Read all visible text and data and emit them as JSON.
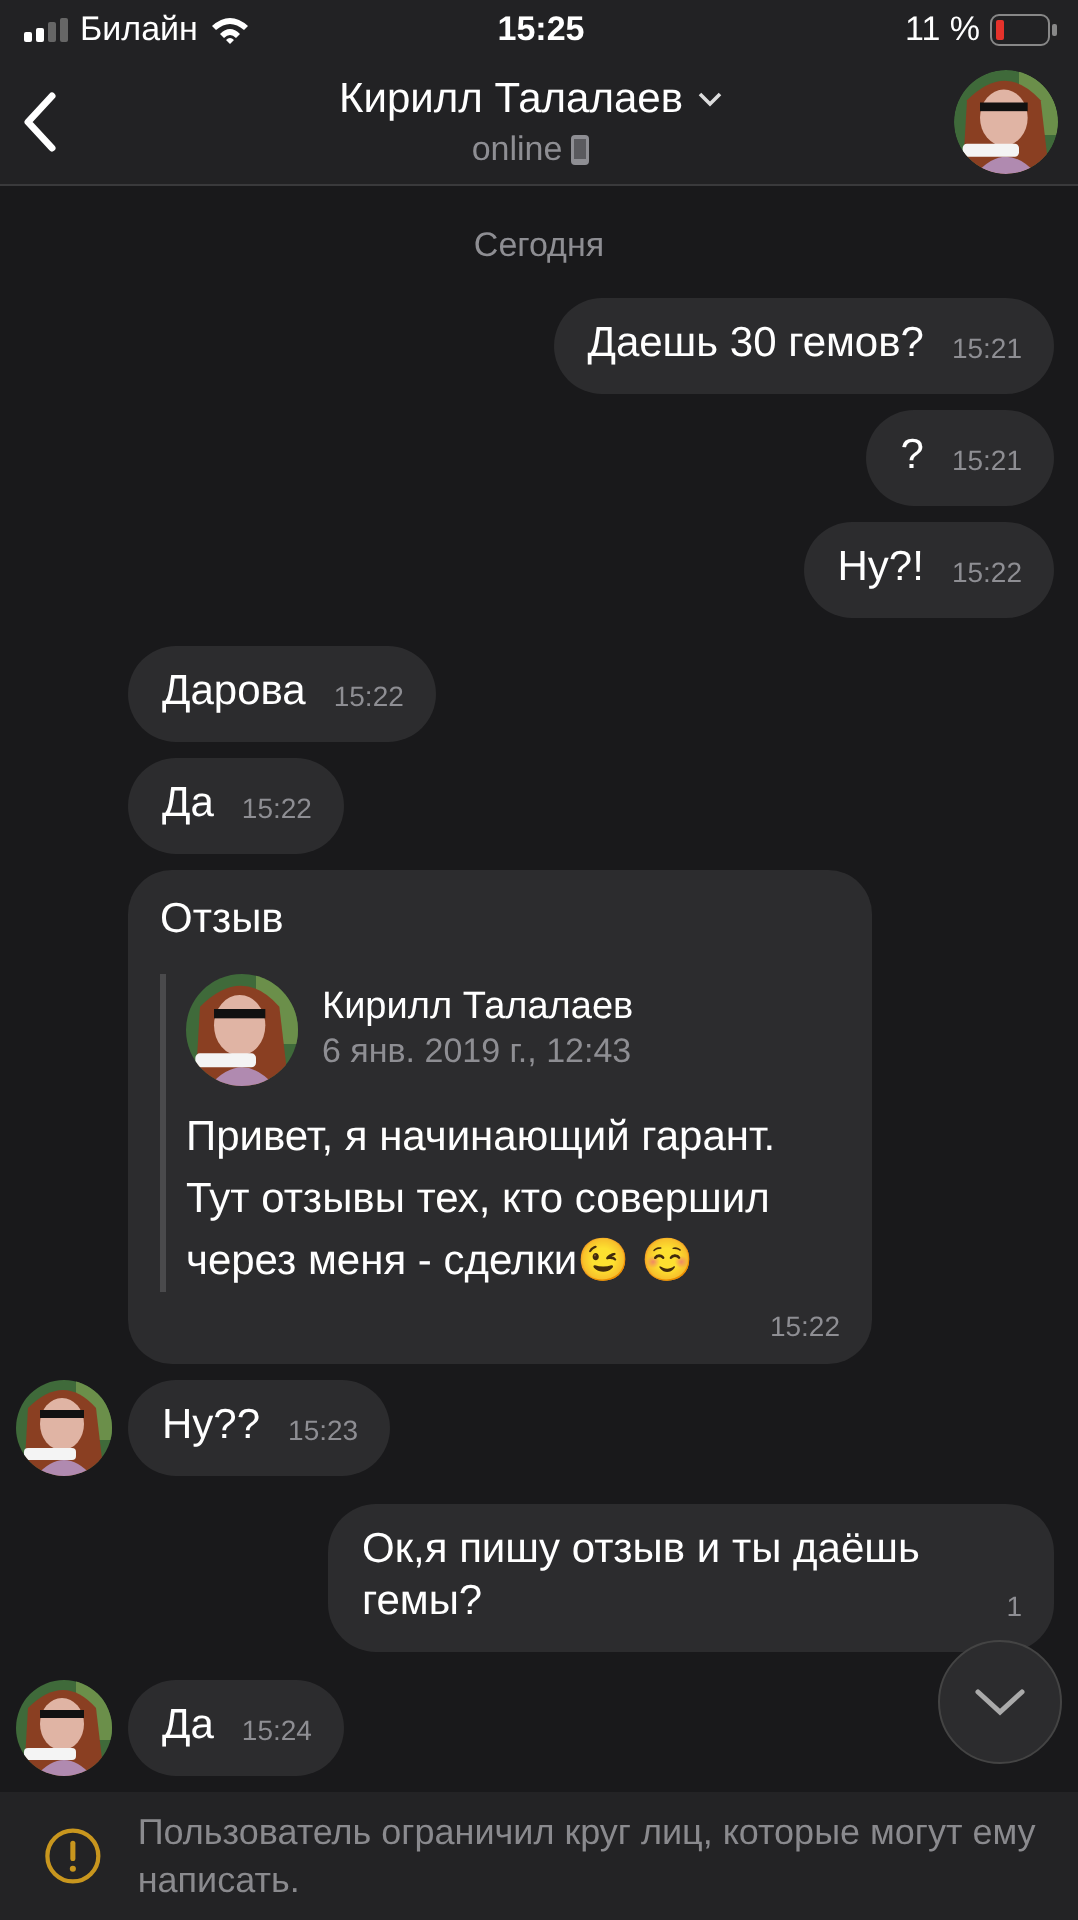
{
  "status_bar": {
    "carrier": "Билайн",
    "time": "15:25",
    "battery": "11 %"
  },
  "header": {
    "name": "Кирилл Талалаев",
    "status": "online"
  },
  "date_divider": "Сегодня",
  "messages": [
    {
      "kind": "text",
      "outgoing": true,
      "text": "Даешь 30 гемов?",
      "time": "15:21",
      "avatar": false
    },
    {
      "kind": "text",
      "outgoing": true,
      "text": "?",
      "time": "15:21",
      "avatar": false
    },
    {
      "kind": "text",
      "outgoing": true,
      "text": "Ну?!",
      "time": "15:22",
      "avatar": false
    },
    {
      "kind": "text",
      "outgoing": false,
      "text": "Дарова",
      "time": "15:22",
      "avatar": false
    },
    {
      "kind": "text",
      "outgoing": false,
      "text": "Да",
      "time": "15:22",
      "avatar": false
    },
    {
      "kind": "quote",
      "outgoing": false,
      "title": "Отзыв",
      "quote": {
        "author": "Кирилл Талалаев",
        "date": "6 янв. 2019 г., 12:43",
        "text": "Привет, я начинающий гарант. Тут отзывы тех, кто совершил через меня - сделки😉 ☺️"
      },
      "time": "15:22",
      "avatar": false
    },
    {
      "kind": "text",
      "outgoing": false,
      "text": "Ну??",
      "time": "15:23",
      "avatar": true
    },
    {
      "kind": "text",
      "outgoing": true,
      "text": "Ок,я пишу отзыв и ты даёшь гемы?",
      "time": "1",
      "avatar": false
    },
    {
      "kind": "text",
      "outgoing": false,
      "text": "Да",
      "time": "15:24",
      "avatar": true
    }
  ],
  "notice": "Пользователь ограничил круг лиц, которые могут ему написать."
}
